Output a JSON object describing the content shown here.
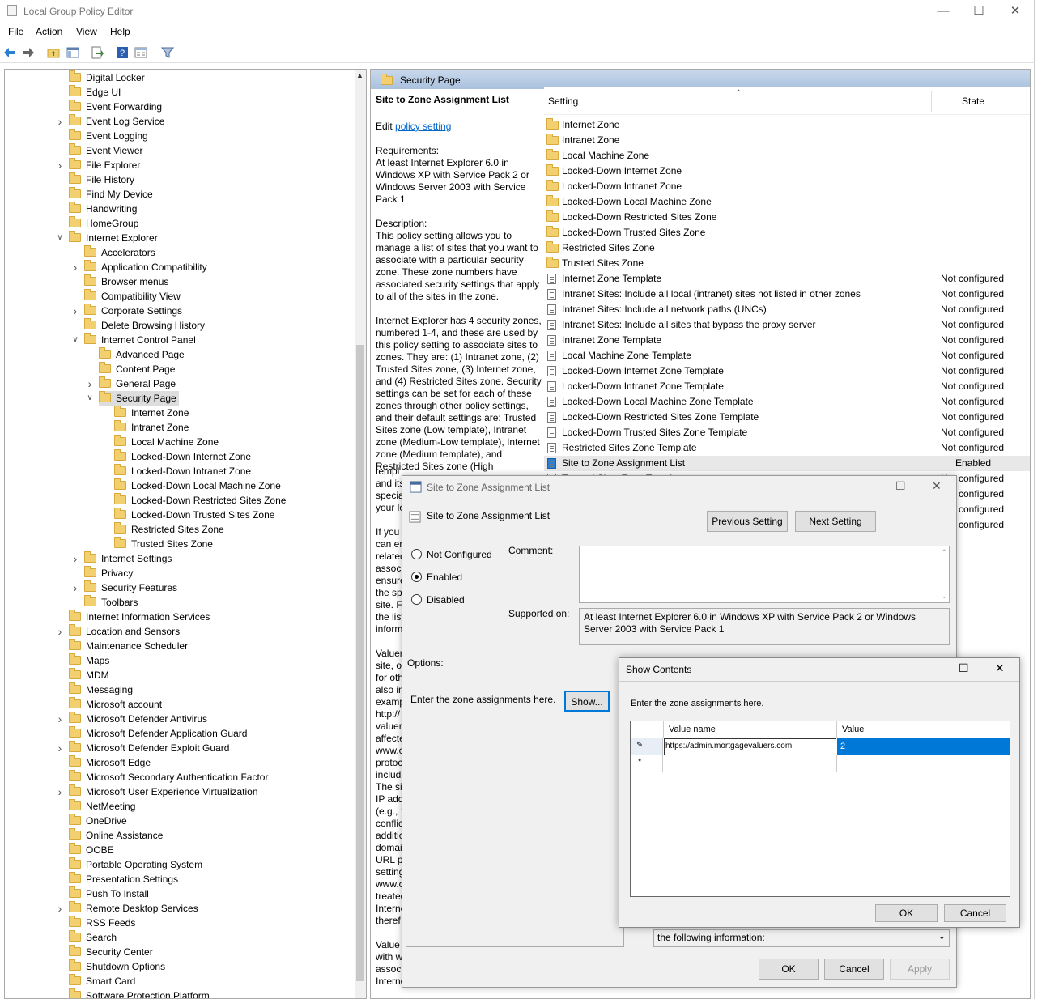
{
  "window": {
    "title": "Local Group Policy Editor"
  },
  "menu": [
    "File",
    "Action",
    "View",
    "Help"
  ],
  "tree": {
    "items": [
      {
        "label": "Digital Locker",
        "level": 0,
        "exp": ""
      },
      {
        "label": "Edge UI",
        "level": 0,
        "exp": ""
      },
      {
        "label": "Event Forwarding",
        "level": 0,
        "exp": ""
      },
      {
        "label": "Event Log Service",
        "level": 0,
        "exp": ">"
      },
      {
        "label": "Event Logging",
        "level": 0,
        "exp": ""
      },
      {
        "label": "Event Viewer",
        "level": 0,
        "exp": ""
      },
      {
        "label": "File Explorer",
        "level": 0,
        "exp": ">"
      },
      {
        "label": "File History",
        "level": 0,
        "exp": ""
      },
      {
        "label": "Find My Device",
        "level": 0,
        "exp": ""
      },
      {
        "label": "Handwriting",
        "level": 0,
        "exp": ""
      },
      {
        "label": "HomeGroup",
        "level": 0,
        "exp": ""
      },
      {
        "label": "Internet Explorer",
        "level": 0,
        "exp": "v"
      },
      {
        "label": "Accelerators",
        "level": 1,
        "exp": ""
      },
      {
        "label": "Application Compatibility",
        "level": 1,
        "exp": ">"
      },
      {
        "label": "Browser menus",
        "level": 1,
        "exp": ""
      },
      {
        "label": "Compatibility View",
        "level": 1,
        "exp": ""
      },
      {
        "label": "Corporate Settings",
        "level": 1,
        "exp": ">"
      },
      {
        "label": "Delete Browsing History",
        "level": 1,
        "exp": ""
      },
      {
        "label": "Internet Control Panel",
        "level": 1,
        "exp": "v"
      },
      {
        "label": "Advanced Page",
        "level": 2,
        "exp": ""
      },
      {
        "label": "Content Page",
        "level": 2,
        "exp": ""
      },
      {
        "label": "General Page",
        "level": 2,
        "exp": ">"
      },
      {
        "label": "Security Page",
        "level": 2,
        "exp": "v",
        "selected": true
      },
      {
        "label": "Internet Zone",
        "level": 3,
        "exp": ""
      },
      {
        "label": "Intranet Zone",
        "level": 3,
        "exp": ""
      },
      {
        "label": "Local Machine Zone",
        "level": 3,
        "exp": ""
      },
      {
        "label": "Locked-Down Internet Zone",
        "level": 3,
        "exp": ""
      },
      {
        "label": "Locked-Down Intranet Zone",
        "level": 3,
        "exp": ""
      },
      {
        "label": "Locked-Down Local Machine Zone",
        "level": 3,
        "exp": ""
      },
      {
        "label": "Locked-Down Restricted Sites Zone",
        "level": 3,
        "exp": ""
      },
      {
        "label": "Locked-Down Trusted Sites Zone",
        "level": 3,
        "exp": ""
      },
      {
        "label": "Restricted Sites Zone",
        "level": 3,
        "exp": ""
      },
      {
        "label": "Trusted Sites Zone",
        "level": 3,
        "exp": ""
      },
      {
        "label": "Internet Settings",
        "level": 1,
        "exp": ">"
      },
      {
        "label": "Privacy",
        "level": 1,
        "exp": ""
      },
      {
        "label": "Security Features",
        "level": 1,
        "exp": ">"
      },
      {
        "label": "Toolbars",
        "level": 1,
        "exp": ""
      },
      {
        "label": "Internet Information Services",
        "level": 0,
        "exp": ""
      },
      {
        "label": "Location and Sensors",
        "level": 0,
        "exp": ">"
      },
      {
        "label": "Maintenance Scheduler",
        "level": 0,
        "exp": ""
      },
      {
        "label": "Maps",
        "level": 0,
        "exp": ""
      },
      {
        "label": "MDM",
        "level": 0,
        "exp": ""
      },
      {
        "label": "Messaging",
        "level": 0,
        "exp": ""
      },
      {
        "label": "Microsoft account",
        "level": 0,
        "exp": ""
      },
      {
        "label": "Microsoft Defender Antivirus",
        "level": 0,
        "exp": ">"
      },
      {
        "label": "Microsoft Defender Application Guard",
        "level": 0,
        "exp": ""
      },
      {
        "label": "Microsoft Defender Exploit Guard",
        "level": 0,
        "exp": ">"
      },
      {
        "label": "Microsoft Edge",
        "level": 0,
        "exp": ""
      },
      {
        "label": "Microsoft Secondary Authentication Factor",
        "level": 0,
        "exp": ""
      },
      {
        "label": "Microsoft User Experience Virtualization",
        "level": 0,
        "exp": ">"
      },
      {
        "label": "NetMeeting",
        "level": 0,
        "exp": ""
      },
      {
        "label": "OneDrive",
        "level": 0,
        "exp": ""
      },
      {
        "label": "Online Assistance",
        "level": 0,
        "exp": ""
      },
      {
        "label": "OOBE",
        "level": 0,
        "exp": ""
      },
      {
        "label": "Portable Operating System",
        "level": 0,
        "exp": ""
      },
      {
        "label": "Presentation Settings",
        "level": 0,
        "exp": ""
      },
      {
        "label": "Push To Install",
        "level": 0,
        "exp": ""
      },
      {
        "label": "Remote Desktop Services",
        "level": 0,
        "exp": ">"
      },
      {
        "label": "RSS Feeds",
        "level": 0,
        "exp": ""
      },
      {
        "label": "Search",
        "level": 0,
        "exp": ""
      },
      {
        "label": "Security Center",
        "level": 0,
        "exp": ""
      },
      {
        "label": "Shutdown Options",
        "level": 0,
        "exp": ""
      },
      {
        "label": "Smart Card",
        "level": 0,
        "exp": ""
      },
      {
        "label": "Software Protection Platform",
        "level": 0,
        "exp": ""
      }
    ]
  },
  "panel": {
    "header": "Security Page",
    "title": "Site to Zone Assignment List",
    "edit_prefix": "Edit",
    "edit_link": "policy setting",
    "requirements_label": "Requirements:",
    "requirements": "At least Internet Explorer 6.0 in Windows XP with Service Pack 2 or Windows Server 2003 with Service Pack 1",
    "description_label": "Description:",
    "description1": "This policy setting allows you to manage a list of sites that you want to associate with a particular security zone. These zone numbers have associated security settings that apply to all of the sites in the zone.",
    "description2": "Internet Explorer has 4 security zones, numbered 1-4, and these are used by this policy setting to associate sites to zones. They are: (1) Intranet zone, (2) Trusted Sites zone, (3) Internet zone, and (4) Restricted Sites zone. Security settings can be set for each of these zones through other policy settings, and their default settings are: Trusted Sites zone (Low template), Intranet zone (Medium-Low template), Internet zone (Medium template), and Restricted Sites zone (High",
    "hidden_fragments": [
      "templ",
      "and its",
      "specia",
      "your lo",
      "If you",
      "can en",
      "related",
      "associ",
      "ensure",
      "the sp",
      "site.  F",
      "the list",
      "inform",
      "Valuer",
      "site, o",
      "for oth",
      "also in",
      "examp",
      "http://",
      "valuer",
      "affecte",
      "www.c",
      "protoc",
      "includ",
      "The sit",
      "IP add",
      "(e.g., 1",
      "conflic",
      "additic",
      "domai",
      "URL pa",
      "setting",
      "www.c",
      "treated",
      "Interne",
      "theref",
      "Value",
      "with w",
      "associ",
      "Internet Explorer zones described"
    ]
  },
  "list": {
    "col_setting": "Setting",
    "col_state": "State",
    "rows": [
      {
        "name": "Internet Zone",
        "state": "",
        "type": "folder"
      },
      {
        "name": "Intranet Zone",
        "state": "",
        "type": "folder"
      },
      {
        "name": "Local Machine Zone",
        "state": "",
        "type": "folder"
      },
      {
        "name": "Locked-Down Internet Zone",
        "state": "",
        "type": "folder"
      },
      {
        "name": "Locked-Down Intranet Zone",
        "state": "",
        "type": "folder"
      },
      {
        "name": "Locked-Down Local Machine Zone",
        "state": "",
        "type": "folder"
      },
      {
        "name": "Locked-Down Restricted Sites Zone",
        "state": "",
        "type": "folder"
      },
      {
        "name": "Locked-Down Trusted Sites Zone",
        "state": "",
        "type": "folder"
      },
      {
        "name": "Restricted Sites Zone",
        "state": "",
        "type": "folder"
      },
      {
        "name": "Trusted Sites Zone",
        "state": "",
        "type": "folder"
      },
      {
        "name": "Internet Zone Template",
        "state": "Not configured",
        "type": "policy"
      },
      {
        "name": "Intranet Sites: Include all local (intranet) sites not listed in other zones",
        "state": "Not configured",
        "type": "policy"
      },
      {
        "name": "Intranet Sites: Include all network paths (UNCs)",
        "state": "Not configured",
        "type": "policy"
      },
      {
        "name": "Intranet Sites: Include all sites that bypass the proxy server",
        "state": "Not configured",
        "type": "policy"
      },
      {
        "name": "Intranet Zone Template",
        "state": "Not configured",
        "type": "policy"
      },
      {
        "name": "Local Machine Zone Template",
        "state": "Not configured",
        "type": "policy"
      },
      {
        "name": "Locked-Down Internet Zone Template",
        "state": "Not configured",
        "type": "policy"
      },
      {
        "name": "Locked-Down Intranet Zone Template",
        "state": "Not configured",
        "type": "policy"
      },
      {
        "name": "Locked-Down Local Machine Zone Template",
        "state": "Not configured",
        "type": "policy"
      },
      {
        "name": "Locked-Down Restricted Sites Zone Template",
        "state": "Not configured",
        "type": "policy"
      },
      {
        "name": "Locked-Down Trusted Sites Zone Template",
        "state": "Not configured",
        "type": "policy"
      },
      {
        "name": "Restricted Sites Zone Template",
        "state": "Not configured",
        "type": "policy"
      },
      {
        "name": "Site to Zone Assignment List",
        "state": "Enabled",
        "type": "policy",
        "highlight": true
      },
      {
        "name": "Trusted Sites Zone Template",
        "state": "Not configured",
        "type": "policy"
      },
      {
        "name": "",
        "state": "Not configured",
        "type": "none"
      },
      {
        "name": "",
        "state": "Not configured",
        "type": "none"
      },
      {
        "name": "",
        "state": "Not configured",
        "type": "none"
      }
    ]
  },
  "policy_dialog": {
    "title": "Site to Zone Assignment List",
    "heading": "Site to Zone Assignment List",
    "prev_btn": "Previous Setting",
    "next_btn": "Next Setting",
    "radio_not_configured": "Not Configured",
    "radio_enabled": "Enabled",
    "radio_disabled": "Disabled",
    "comment_label": "Comment:",
    "supported_label": "Supported on:",
    "supported_text": "At least Internet Explorer 6.0 in Windows XP with Service Pack 2 or Windows Server 2003 with Service Pack 1",
    "options_label": "Options:",
    "options_text": "Enter the zone assignments here.",
    "show_btn": "Show...",
    "help_fragment": "the following information:",
    "ok": "OK",
    "cancel": "Cancel",
    "apply": "Apply"
  },
  "show_dialog": {
    "title": "Show Contents",
    "instruction": "Enter the zone assignments here.",
    "col_name": "Value name",
    "col_value": "Value",
    "row_name": "https://admin.mortgagevaluers.com",
    "row_value": "2",
    "ok": "OK",
    "cancel": "Cancel"
  }
}
